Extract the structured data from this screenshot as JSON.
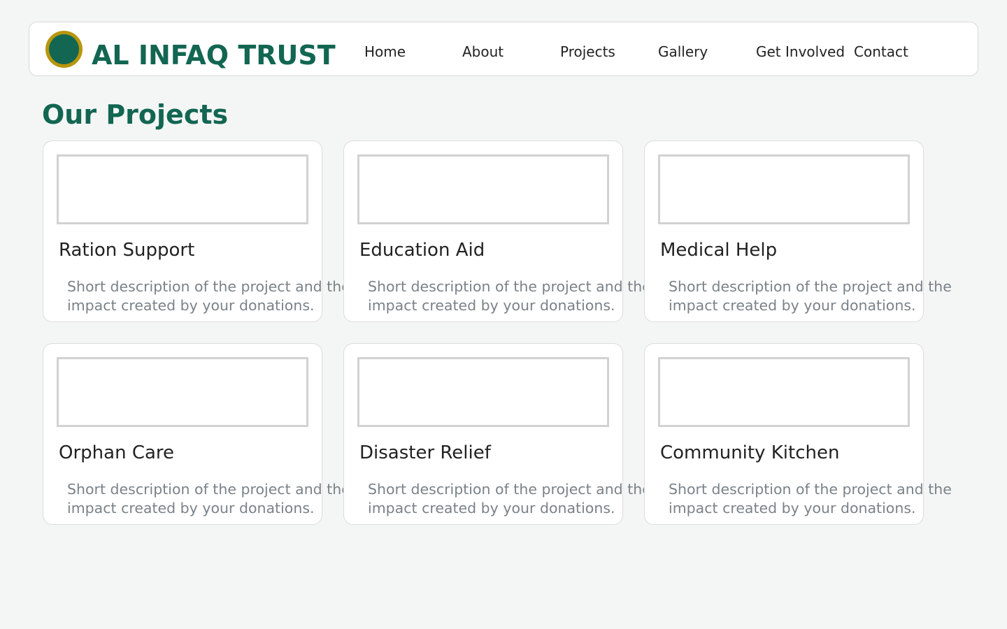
{
  "header": {
    "brand": "AL INFAQ TRUST",
    "nav": [
      {
        "label": "Home"
      },
      {
        "label": "About"
      },
      {
        "label": "Projects"
      },
      {
        "label": "Gallery"
      },
      {
        "label": "Get Involved"
      },
      {
        "label": "Contact"
      }
    ]
  },
  "colors": {
    "brand_green": "#126652",
    "logo_gold": "#b8960c",
    "background": "#f4f6f5"
  },
  "main": {
    "title": "Our Projects",
    "projects": [
      {
        "title": "Ration Support",
        "description": "Short description of the project and the impact created by your donations."
      },
      {
        "title": "Education Aid",
        "description": "Short description of the project and the impact created by your donations."
      },
      {
        "title": "Medical Help",
        "description": "Short description of the project and the impact created by your donations."
      },
      {
        "title": "Orphan Care",
        "description": "Short description of the project and the impact created by your donations."
      },
      {
        "title": "Disaster Relief",
        "description": "Short description of the project and the impact created by your donations."
      },
      {
        "title": "Community Kitchen",
        "description": "Short description of the project and the impact created by your donations."
      }
    ]
  }
}
